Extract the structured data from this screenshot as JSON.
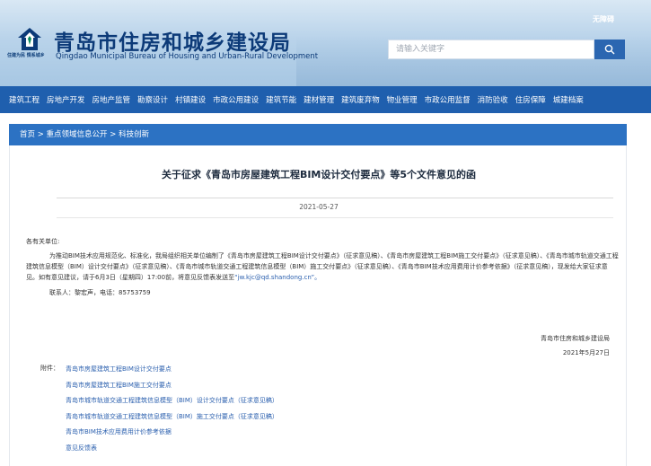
{
  "header": {
    "title_cn": "青岛市住房和城乡建设局",
    "title_en": "Qingdao Municipal Bureau of Housing and Urban-Rural Development",
    "emblem_caption": "住建为民 情系城乡",
    "top_link": "无障碍",
    "search_placeholder": "请输入关键字",
    "colors": {
      "brand": "#0c3a78",
      "nav": "#1f5fae",
      "breadcrumb": "#2c72c3"
    }
  },
  "nav": {
    "items": [
      "建筑工程",
      "房地产开发",
      "房地产监管",
      "勘察设计",
      "村镇建设",
      "市政公用建设",
      "建筑节能",
      "建材管理",
      "建筑废弃物",
      "物业管理",
      "市政公用监督",
      "消防验收",
      "住房保障",
      "城建档案"
    ]
  },
  "breadcrumb": [
    "首页",
    "重点领域信息公开",
    "科技创新"
  ],
  "breadcrumb_sep": " > ",
  "article": {
    "title": "关于征求《青岛市房屋建筑工程BIM设计交付要点》等5个文件意见的函",
    "date": "2021-05-27",
    "salutation": "各有关单位:",
    "paragraph": "为推动BIM技术应用规范化、标准化，我局组织相关单位编制了《青岛市房屋建筑工程BIM设计交付要点》（征求意见稿）、《青岛市房屋建筑工程BIM施工交付要点》（征求意见稿）、《青岛市城市轨道交通工程建筑信息模型（BIM）设计交付要点》（征求意见稿）、《青岛市城市轨道交通工程建筑信息模型（BIM）施工交付要点》（征求意见稿）、《青岛市BIM技术应用费用计价参考依据》（征求意见稿），现发给大家征求意见。如有意见建议，请于6月3日（星期四）17:00前，将意见反馈表发送至",
    "email": "“jw.kjc@qd.shandong.cn”。",
    "contact": "联系人：黎宏声，电话：85753759",
    "sign_org": "青岛市住房和城乡建设局",
    "sign_date": "2021年5月27日",
    "attachment_label": "附件：",
    "attachments": [
      "青岛市房屋建筑工程BIM设计交付要点",
      "青岛市房屋建筑工程BIM施工交付要点",
      "青岛市城市轨道交通工程建筑信息模型（BIM）设计交付要点（征求意见稿）",
      "青岛市城市轨道交通工程建筑信息模型（BIM）施工交付要点（征求意见稿）",
      "青岛市BIM技术应用费用计价参考依据",
      "意见反馈表"
    ]
  }
}
